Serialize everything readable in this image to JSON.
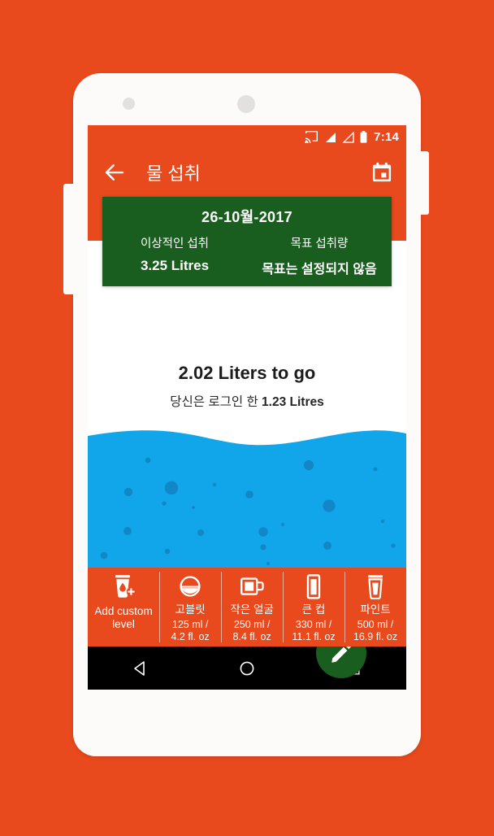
{
  "statusbar": {
    "time": "7:14",
    "icons": [
      "cast-icon",
      "signal-icon",
      "signal-outline-icon",
      "battery-icon"
    ]
  },
  "appbar": {
    "back_icon": "back-arrow-icon",
    "title": "물 섭취",
    "calendar_icon": "calendar-icon"
  },
  "summary_card": {
    "date": "26-10월-2017",
    "ideal_label": "이상적인 섭취",
    "ideal_value": "3.25  Litres",
    "goal_label": "목표 섭취량",
    "goal_value": "목표는 설정되지 않음"
  },
  "progress": {
    "to_go": "2.02  Liters to go",
    "logged_prefix": "당신은 로그인 한 ",
    "logged_value": "1.23 Litres"
  },
  "fab": {
    "icon": "pencil-icon"
  },
  "drinks": [
    {
      "icon": "custom-cup-plus-icon",
      "name": "Add custom\nlevel",
      "name_line1": "Add custom",
      "name_line2": "level",
      "volume": "",
      "volume_line1": "",
      "volume_line2": ""
    },
    {
      "icon": "goblet-icon",
      "name": "고블릿",
      "volume_line1": "125 ml /",
      "volume_line2": "4.2 fl. oz"
    },
    {
      "icon": "mug-icon",
      "name": "작은 얼굴",
      "volume_line1": "250 ml /",
      "volume_line2": "8.4 fl. oz"
    },
    {
      "icon": "tall-glass-icon",
      "name": "큰 컵",
      "volume_line1": "330 ml /",
      "volume_line2": "11.1 fl. oz"
    },
    {
      "icon": "pint-cup-icon",
      "name": "파인트",
      "volume_line1": "500 ml /",
      "volume_line2": "16.9 fl. oz"
    }
  ],
  "navbar": {
    "back": "nav-back-icon",
    "home": "nav-home-icon",
    "recents": "nav-recents-icon"
  },
  "colors": {
    "background": "#e8491d",
    "accent_orange": "#e8491d",
    "card_green": "#1a5e1f",
    "water_blue": "#11a6ea",
    "bubble_blue": "#1187c7",
    "phone_white": "#fdfbfa",
    "nav_black": "#000000"
  }
}
